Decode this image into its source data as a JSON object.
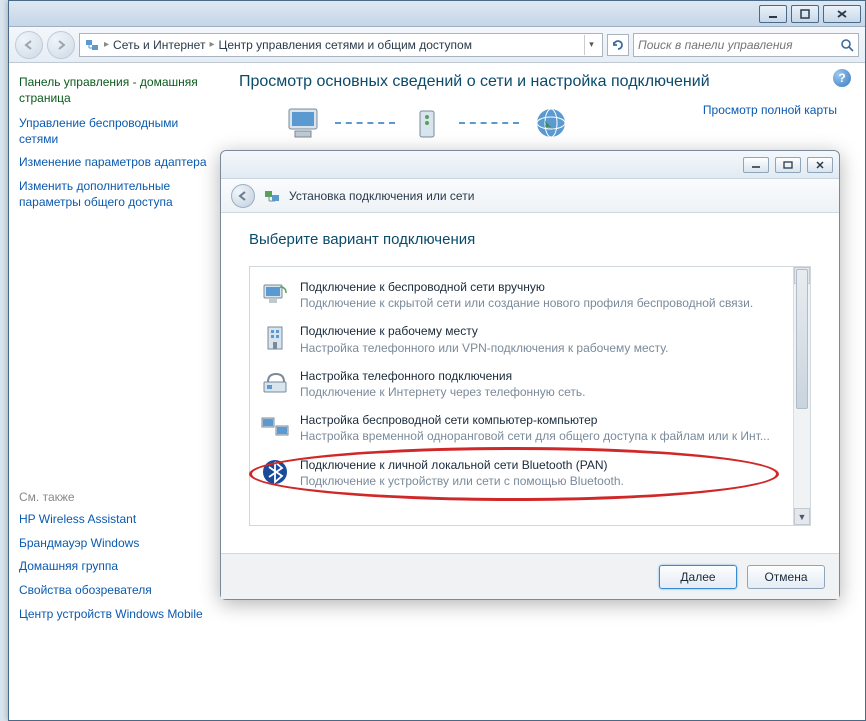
{
  "breadcrumb": {
    "item1": "Сеть и Интернет",
    "item2": "Центр управления сетями и общим доступом"
  },
  "search": {
    "placeholder": "Поиск в панели управления"
  },
  "sidebar": {
    "heading": "Панель управления - домашняя страница",
    "links": [
      "Управление беспроводными сетями",
      "Изменение параметров адаптера",
      "Изменить дополнительные параметры общего доступа"
    ],
    "seealso_heading": "См. также",
    "seealso": [
      "HP Wireless Assistant",
      "Брандмауэр Windows",
      "Домашняя группа",
      "Свойства обозревателя",
      "Центр устройств Windows Mobile"
    ]
  },
  "main": {
    "heading": "Просмотр основных сведений о сети и настройка подключений",
    "map_link": "Просмотр полной карты"
  },
  "wizard": {
    "title": "Установка подключения или сети",
    "heading": "Выберите вариант подключения",
    "options": [
      {
        "t1": "Подключение к беспроводной сети вручную",
        "t2": "Подключение к скрытой сети или создание нового профиля беспроводной связи."
      },
      {
        "t1": "Подключение к рабочему месту",
        "t2": "Настройка телефонного или VPN-подключения к рабочему месту."
      },
      {
        "t1": "Настройка телефонного подключения",
        "t2": "Подключение к Интернету через телефонную сеть."
      },
      {
        "t1": "Настройка беспроводной сети компьютер-компьютер",
        "t2": "Настройка временной одноранговой сети для общего доступа к файлам или к Инт..."
      },
      {
        "t1": "Подключение к личной локальной сети Bluetooth (PAN)",
        "t2": "Подключение к устройству или сети с помощью Bluetooth."
      }
    ],
    "btn_next": "Далее",
    "btn_cancel": "Отмена"
  }
}
